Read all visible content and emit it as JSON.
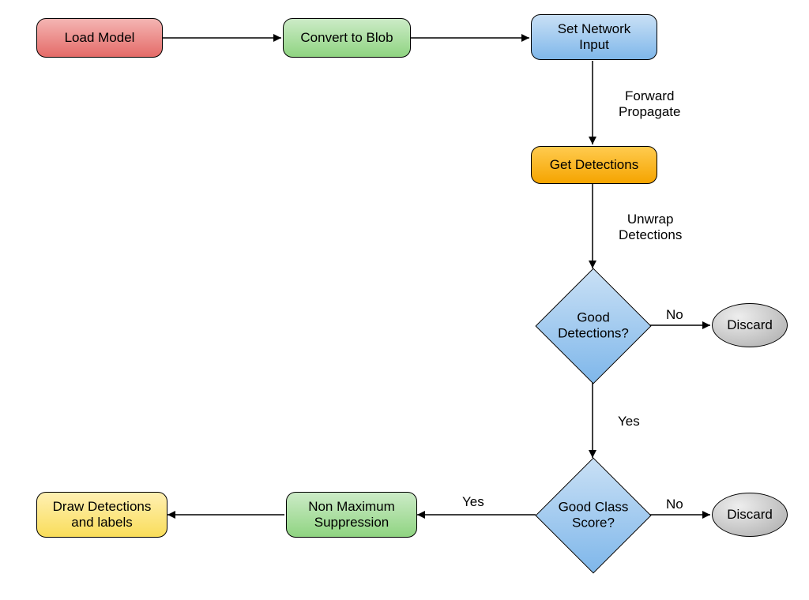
{
  "chart_data": {
    "type": "flowchart",
    "nodes": [
      {
        "id": "load_model",
        "label": "Load Model",
        "shape": "rounded-rect",
        "color": "red"
      },
      {
        "id": "convert_blob",
        "label": "Convert to Blob",
        "shape": "rounded-rect",
        "color": "green"
      },
      {
        "id": "set_input",
        "label": "Set Network\nInput",
        "shape": "rounded-rect",
        "color": "blue"
      },
      {
        "id": "get_detections",
        "label": "Get Detections",
        "shape": "rounded-rect",
        "color": "orange"
      },
      {
        "id": "good_detections",
        "label": "Good\nDetections?",
        "shape": "diamond",
        "color": "blue"
      },
      {
        "id": "discard1",
        "label": "Discard",
        "shape": "ellipse",
        "color": "grey"
      },
      {
        "id": "good_class",
        "label": "Good Class\nScore?",
        "shape": "diamond",
        "color": "blue"
      },
      {
        "id": "discard2",
        "label": "Discard",
        "shape": "ellipse",
        "color": "grey"
      },
      {
        "id": "nms",
        "label": "Non Maximum\nSuppression",
        "shape": "rounded-rect",
        "color": "green"
      },
      {
        "id": "draw",
        "label": "Draw Detections\nand labels",
        "shape": "rounded-rect",
        "color": "yellow"
      }
    ],
    "edges": [
      {
        "from": "load_model",
        "to": "convert_blob",
        "label": ""
      },
      {
        "from": "convert_blob",
        "to": "set_input",
        "label": ""
      },
      {
        "from": "set_input",
        "to": "get_detections",
        "label": "Forward\nPropagate"
      },
      {
        "from": "get_detections",
        "to": "good_detections",
        "label": "Unwrap\nDetections"
      },
      {
        "from": "good_detections",
        "to": "discard1",
        "label": "No"
      },
      {
        "from": "good_detections",
        "to": "good_class",
        "label": "Yes"
      },
      {
        "from": "good_class",
        "to": "discard2",
        "label": "No"
      },
      {
        "from": "good_class",
        "to": "nms",
        "label": "Yes"
      },
      {
        "from": "nms",
        "to": "draw",
        "label": ""
      }
    ]
  },
  "nodes": {
    "load_model": "Load Model",
    "convert_blob": "Convert to Blob",
    "set_input_l1": "Set Network",
    "set_input_l2": "Input",
    "get_detections": "Get Detections",
    "good_det_l1": "Good",
    "good_det_l2": "Detections?",
    "discard1": "Discard",
    "good_class_l1": "Good Class",
    "good_class_l2": "Score?",
    "discard2": "Discard",
    "nms_l1": "Non Maximum",
    "nms_l2": "Suppression",
    "draw_l1": "Draw Detections",
    "draw_l2": "and labels"
  },
  "edges": {
    "forward_l1": "Forward",
    "forward_l2": "Propagate",
    "unwrap_l1": "Unwrap",
    "unwrap_l2": "Detections",
    "no": "No",
    "yes": "Yes"
  }
}
